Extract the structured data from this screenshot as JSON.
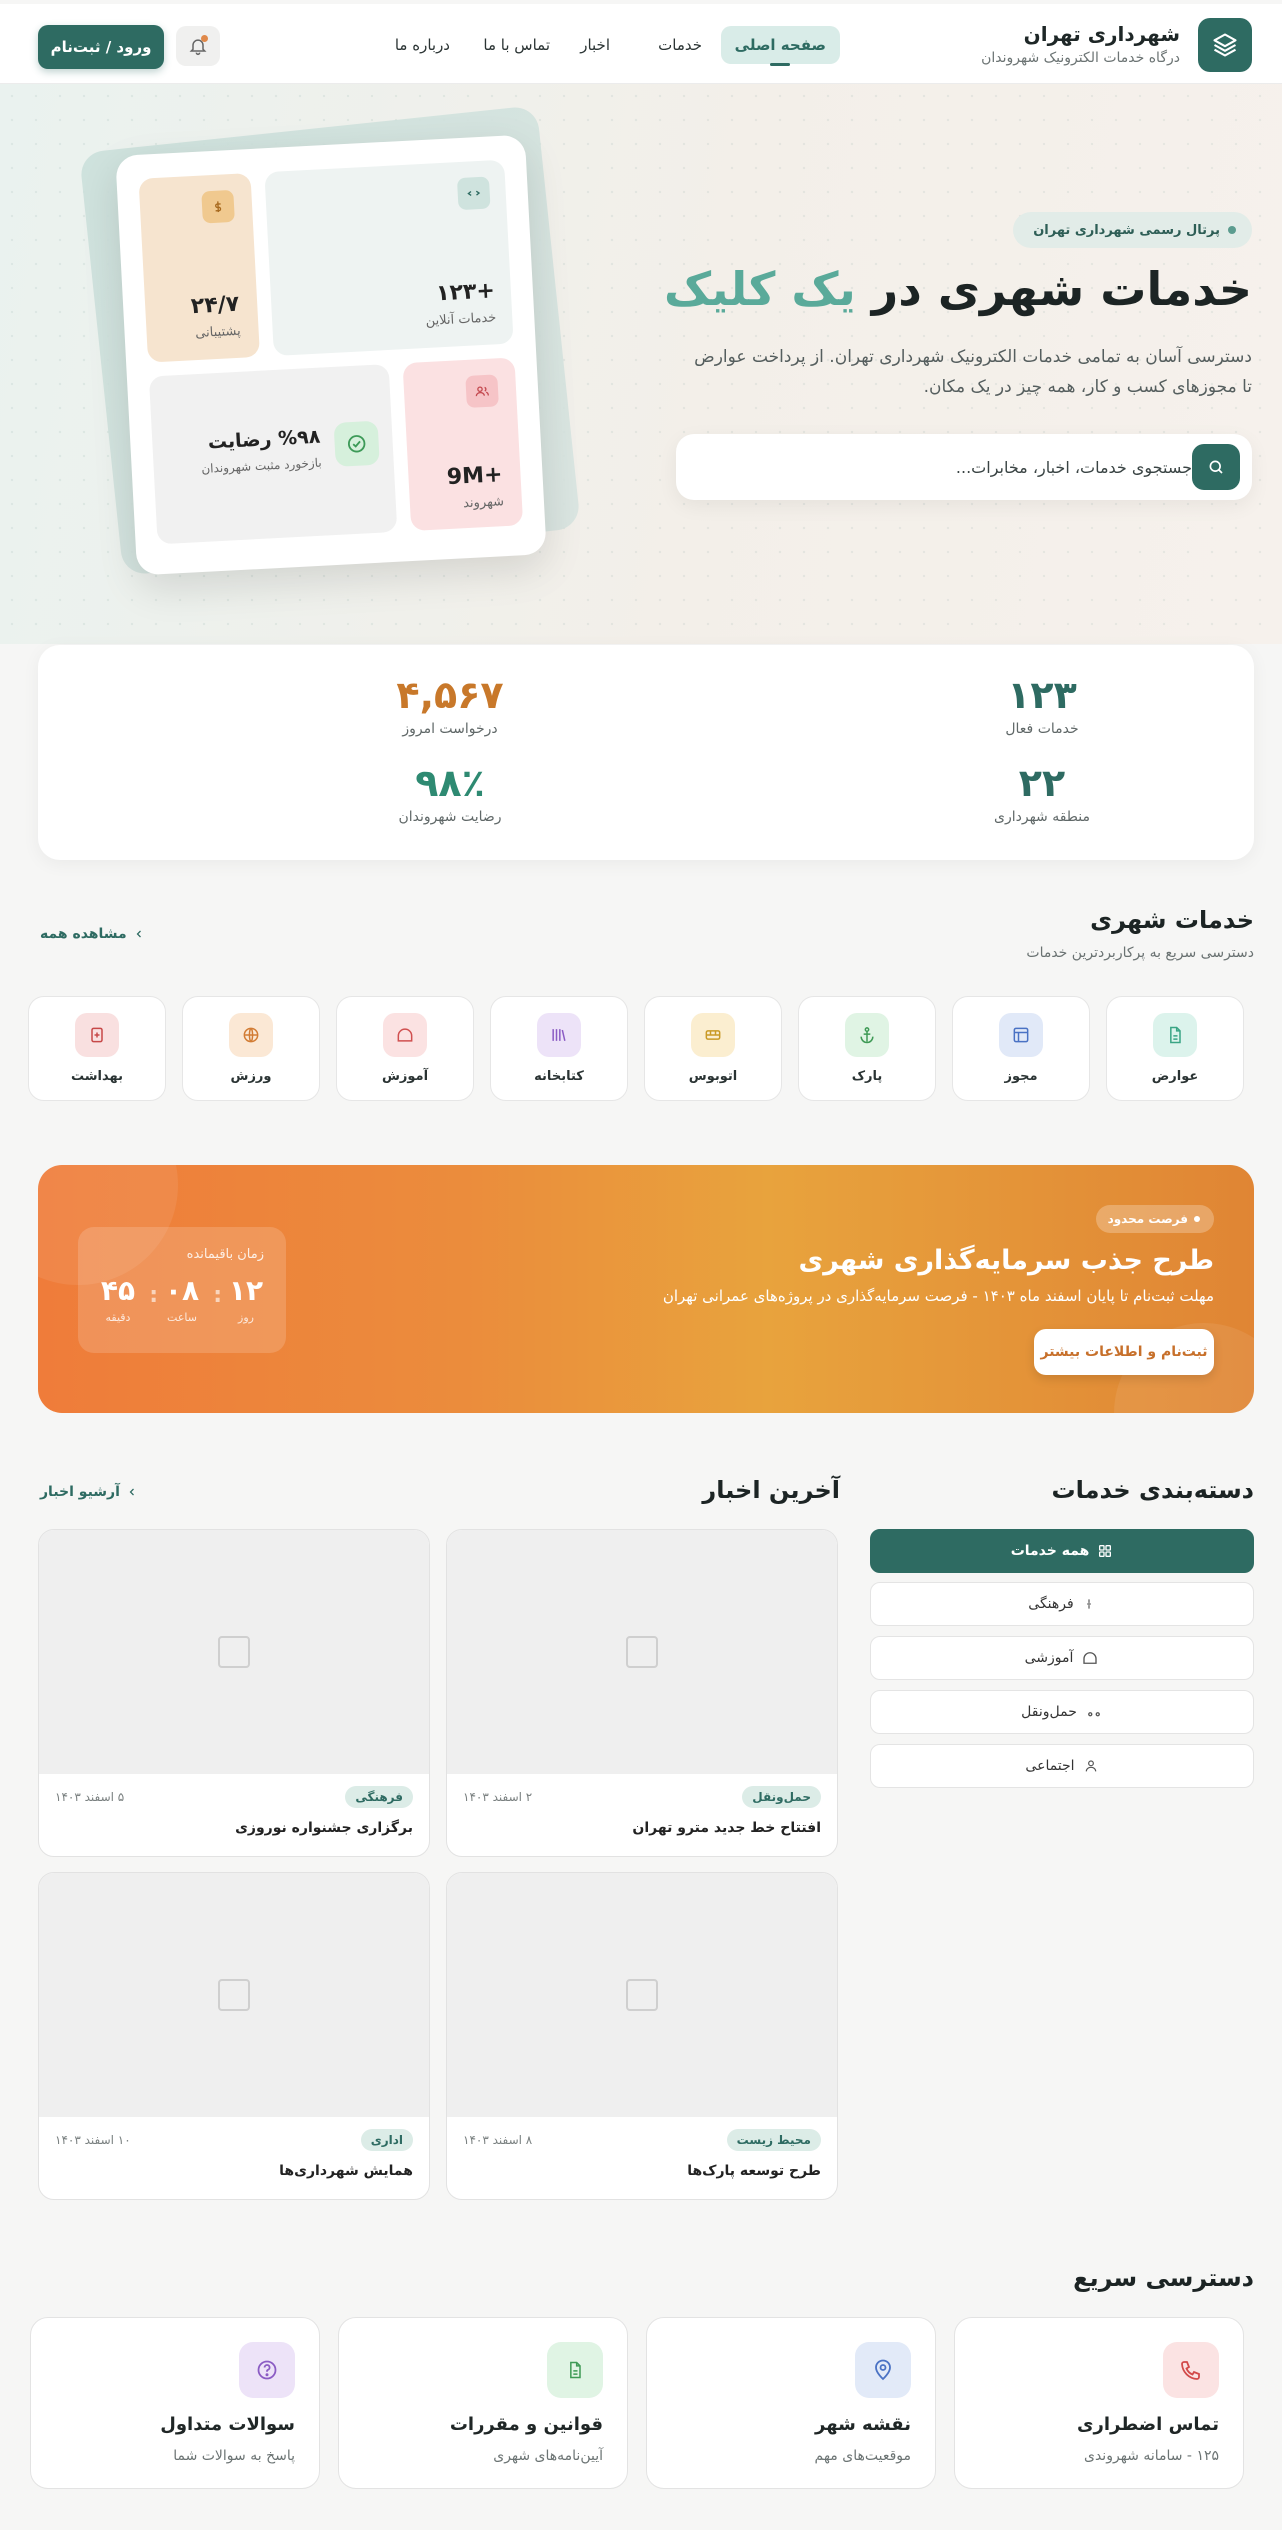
{
  "header": {
    "brand_title": "شهرداری تهران",
    "brand_sub": "درگاه خدمات الکترونیک شهروندان",
    "nav": [
      "صفحه اصلی",
      "خدمات",
      "اخبار",
      "تماس با ما",
      "درباره ما"
    ],
    "active_nav": "صفحه اصلی",
    "login_label": "ورود / ثبت‌نام"
  },
  "hero": {
    "badge": "پرتال رسمی شهرداری تهران",
    "title_main": "خدمات شهری در",
    "title_accent": "یک کلیک",
    "description": "دسترسی آسان به تمامی خدمات الکترونیک شهرداری تهران. از پرداخت عوارض تا مجوزهای کسب و کار، همه چیز در یک مکان.",
    "search_placeholder": "جستجوی خدمات، اخبار، مخابرات...",
    "cards": {
      "online": {
        "value": "+۱۲۳",
        "label": "خدمات آنلاین"
      },
      "support": {
        "value": "۲۴/۷",
        "label": "پشتیبانی"
      },
      "satisfaction": {
        "value": "%۹۸ رضایت",
        "label": "بازخورد مثبت شهروندان"
      },
      "citizens": {
        "value": "+9M",
        "label": "شهروند"
      }
    }
  },
  "stats": [
    {
      "value": "۱۲۳",
      "label": "خدمات فعال",
      "color": "#2e6b62"
    },
    {
      "value": "۴,۵۶۷",
      "label": "درخواست امروز",
      "color": "#c8782a"
    },
    {
      "value": "۲۲",
      "label": "منطقه شهرداری",
      "color": "#2e6b62"
    },
    {
      "value": "۹۸٪",
      "label": "رضایت شهروندان",
      "color": "#2e8a72"
    }
  ],
  "services_section": {
    "title": "خدمات شهری",
    "subtitle": "دسترسی سریع به پرکاربردترین خدمات",
    "view_all": "مشاهده همه",
    "items": [
      {
        "label": "عوارض",
        "icon": "document-icon",
        "bg": "#dcf3ec",
        "fg": "#3aa585"
      },
      {
        "label": "مجوز",
        "icon": "license-icon",
        "bg": "#e1e9f8",
        "fg": "#4a72c4"
      },
      {
        "label": "پارک",
        "icon": "anchor-icon",
        "bg": "#e0f4e4",
        "fg": "#3e9a55"
      },
      {
        "label": "اتوبوس",
        "icon": "bus-icon",
        "bg": "#fbeed0",
        "fg": "#c99a26"
      },
      {
        "label": "کتابخانه",
        "icon": "library-icon",
        "bg": "#ede3f8",
        "fg": "#8b5cc4"
      },
      {
        "label": "آموزش",
        "icon": "education-icon",
        "bg": "#fbe2e2",
        "fg": "#d05050"
      },
      {
        "label": "ورزش",
        "icon": "globe-icon",
        "bg": "#fbe8d5",
        "fg": "#d27c34"
      },
      {
        "label": "بهداشت",
        "icon": "health-icon",
        "bg": "#f9e0e0",
        "fg": "#c74848"
      }
    ]
  },
  "banner": {
    "badge": "فرصت محدود",
    "title": "طرح جذب سرمایه‌گذاری شهری",
    "description": "مهلت ثبت‌نام تا پایان اسفند ماه ۱۴۰۳ - فرصت سرمایه‌گذاری در پروژه‌های عمرانی تهران",
    "button": "ثبت‌نام و اطلاعات بیشتر",
    "timer_caption": "زمان باقیمانده",
    "timer": [
      {
        "value": "۱۲",
        "unit": "روز"
      },
      {
        "value": "۰۸",
        "unit": "ساعت"
      },
      {
        "value": "۴۵",
        "unit": "دقیقه"
      }
    ]
  },
  "categories": {
    "title": "دسته‌بندی خدمات",
    "items": [
      {
        "label": "همه خدمات",
        "icon": "grid-icon",
        "active": true
      },
      {
        "label": "فرهنگی",
        "icon": "sparkle-icon",
        "active": false
      },
      {
        "label": "آموزشی",
        "icon": "education-icon",
        "active": false
      },
      {
        "label": "حمل‌ونقل",
        "icon": "transport-icon",
        "active": false
      },
      {
        "label": "اجتماعی",
        "icon": "user-icon",
        "active": false
      }
    ]
  },
  "news": {
    "title": "آخرین اخبار",
    "archive": "آرشیو اخبار",
    "items": [
      {
        "tag": "حمل‌ونقل",
        "date": "۲ اسفند ۱۴۰۳",
        "title": "افتتاح خط جدید مترو تهران"
      },
      {
        "tag": "فرهنگی",
        "date": "۵ اسفند ۱۴۰۳",
        "title": "برگزاری جشنواره نوروزی"
      },
      {
        "tag": "محیط زیست",
        "date": "۸ اسفند ۱۴۰۳",
        "title": "طرح توسعه پارک‌ها"
      },
      {
        "tag": "اداری",
        "date": "۱۰ اسفند ۱۴۰۳",
        "title": "همایش شهرداری‌ها"
      }
    ]
  },
  "quick_access": {
    "title": "دسترسی سریع",
    "items": [
      {
        "title": "تماس اضطراری",
        "sub": "۱۲۵ - سامانه شهروندی",
        "icon": "phone-icon",
        "bg": "#fbe3e3",
        "fg": "#d24a4a"
      },
      {
        "title": "نقشه شهر",
        "sub": "موقعیت‌های مهم",
        "icon": "map-pin-icon",
        "bg": "#e2eaf8",
        "fg": "#4a72c4"
      },
      {
        "title": "قوانین و مقررات",
        "sub": "آیین‌نامه‌های شهری",
        "icon": "document-icon",
        "bg": "#e0f4e4",
        "fg": "#3e9a55"
      },
      {
        "title": "سوالات متداول",
        "sub": "پاسخ به سوالات شما",
        "icon": "question-icon",
        "bg": "#ede3f8",
        "fg": "#8b5cc4"
      }
    ]
  }
}
